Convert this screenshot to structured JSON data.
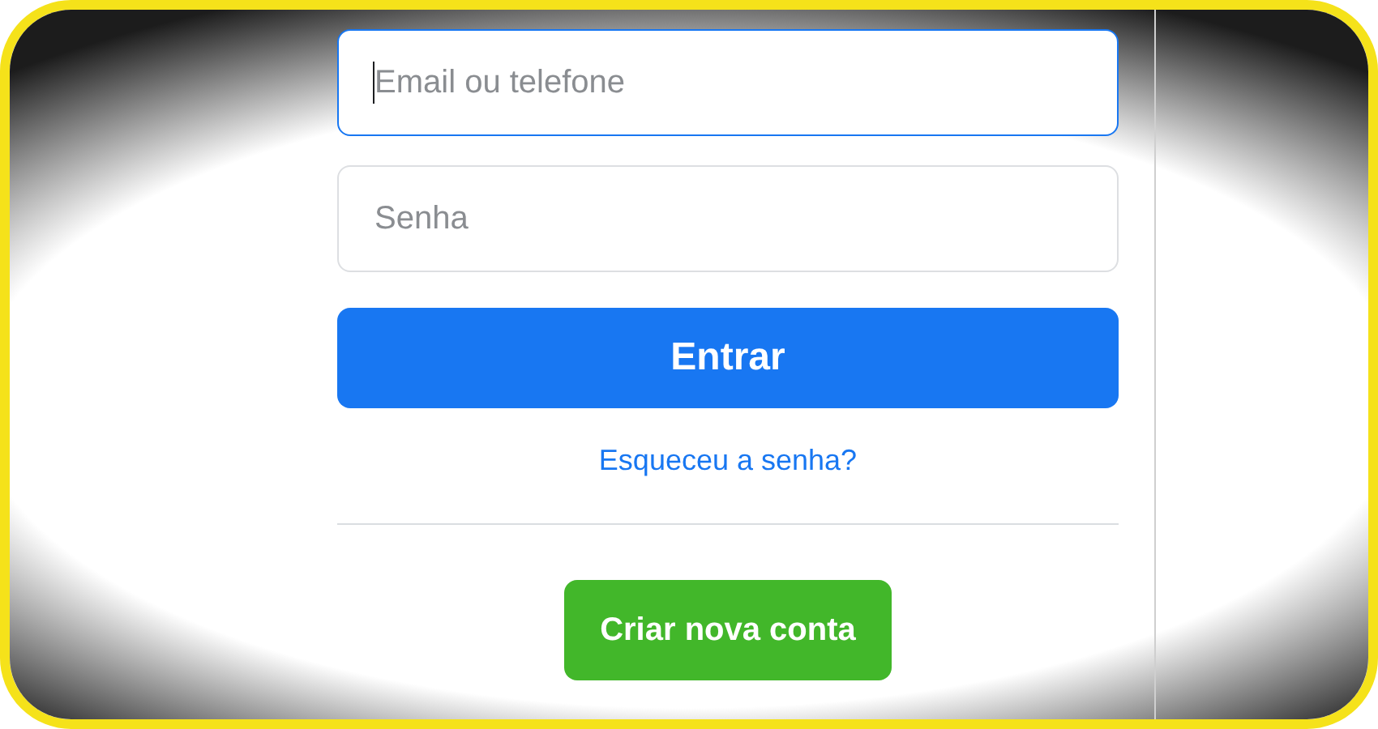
{
  "login_form": {
    "fields": [
      {
        "placeholder": "Email ou telefone",
        "focused": true
      },
      {
        "placeholder": "Senha",
        "focused": false
      }
    ],
    "submit_button": "Entrar",
    "forgot_link": "Esqueceu a senha?",
    "create_account_button": "Criar nova conta"
  }
}
